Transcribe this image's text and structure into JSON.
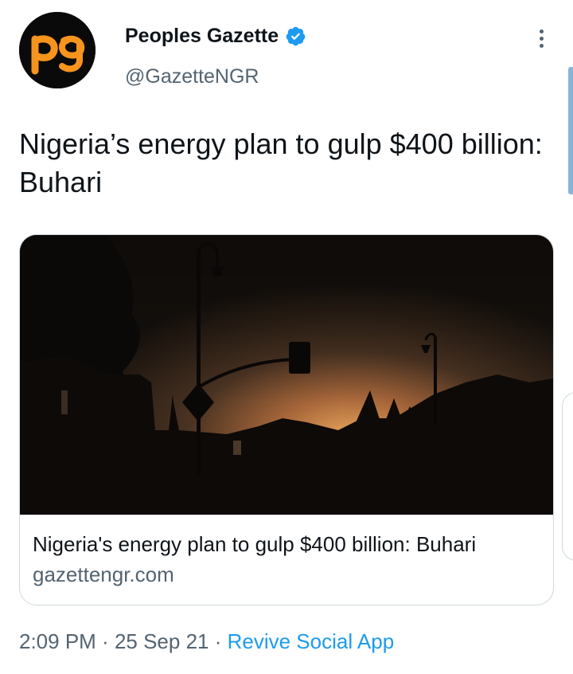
{
  "colors": {
    "avatar_bg": "#0a0a0a",
    "logo_orange": "#f7941d",
    "verified": "#1d9bf0",
    "text_primary": "#0f1419",
    "text_secondary": "#536471",
    "link": "#1d9bf0"
  },
  "author": {
    "avatar_icon": "pg-logo",
    "display_name": "Peoples Gazette",
    "verified_icon": "verified-badge-icon",
    "handle": "@GazetteNGR"
  },
  "more_icon": "more-vertical-icon",
  "tweet": {
    "text": "Nigeria’s energy plan to gulp $400 billion: Buhari"
  },
  "link_card": {
    "image_subject": "night-street-silhouette",
    "title": "Nigeria's energy plan to gulp $400 billion: Buhari",
    "domain": "gazettengr.com"
  },
  "meta": {
    "time": "2:09 PM",
    "separator": " · ",
    "date": "25 Sep 21",
    "source": "Revive Social App"
  }
}
